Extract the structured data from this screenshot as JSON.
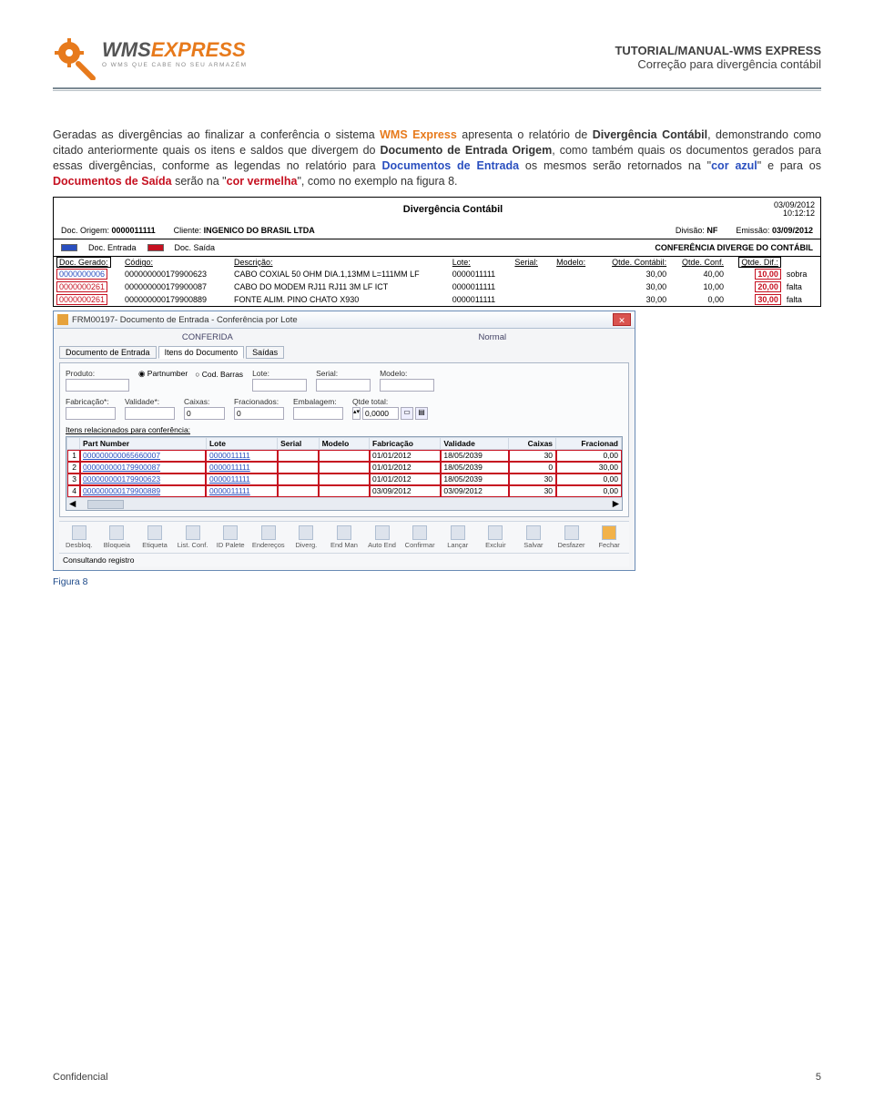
{
  "header": {
    "logo": {
      "wms": "WMS",
      "express": "EXPRESS",
      "tagline": "O WMS QUE CABE NO SEU ARMAZÉM"
    },
    "right_title": "TUTORIAL/MANUAL-WMS EXPRESS",
    "right_sub": "Correção para divergência contábil"
  },
  "paragraph": {
    "seg1": "Geradas as divergências ao finalizar a conferência o sistema ",
    "wms": "WMS Express",
    "seg2": " apresenta o relatório de ",
    "b1": "Divergência Contábil",
    "seg3": ", demonstrando como citado anteriormente quais os itens e saldos que divergem do ",
    "b2": "Documento de Entrada Origem",
    "seg4": ", como também quais os documentos gerados para essas divergências, conforme as legendas no relatório para ",
    "blue1": "Documentos de Entrada",
    "seg5": " os mesmos serão retornados na \"",
    "blue2": "cor azul",
    "seg6": "\" e para os ",
    "red1": "Documentos de Saída",
    "seg7": " serão na \"",
    "red2": "cor vermelha",
    "seg8": "\", como no exemplo na figura 8."
  },
  "report": {
    "title": "Divergência Contábil",
    "date": "03/09/2012",
    "time": "10:12:12",
    "doc_origem_label": "Doc. Origem:",
    "doc_origem": "0000011111",
    "cliente_label": "Cliente:",
    "cliente": "INGENICO DO BRASIL LTDA",
    "divisao_label": "Divisão:",
    "divisao": "NF",
    "emissao_label": "Emissão:",
    "emissao": "03/09/2012",
    "legend_in": "Doc. Entrada",
    "legend_out": "Doc. Saída",
    "conf_div": "CONFERÊNCIA DIVERGE DO CONTÁBIL",
    "cols": {
      "doc": "Doc. Gerado:",
      "cod": "Código:",
      "desc": "Descrição:",
      "lote": "Lote:",
      "serial": "Serial:",
      "modelo": "Modelo:",
      "qc": "Qtde. Contábil:",
      "qf": "Qtde. Conf.",
      "qd": "Qtde. Dif.:",
      "status": ""
    },
    "rows": [
      {
        "doc": "0000000006",
        "doc_color": "blue",
        "cod": "000000000179900623",
        "desc": "CABO COXIAL 50 OHM DIA.1,13MM L=111MM LF",
        "lote": "0000011111",
        "serial": "",
        "modelo": "",
        "qc": "30,00",
        "qf": "40,00",
        "qd": "10,00",
        "status": "sobra"
      },
      {
        "doc": "0000000261",
        "doc_color": "red",
        "cod": "000000000179900087",
        "desc": "CABO DO MODEM RJ11 RJ11 3M LF ICT",
        "lote": "0000011111",
        "serial": "",
        "modelo": "",
        "qc": "30,00",
        "qf": "10,00",
        "qd": "20,00",
        "status": "falta"
      },
      {
        "doc": "0000000261",
        "doc_color": "red",
        "cod": "000000000179900889",
        "desc": "FONTE ALIM. PINO CHATO X930",
        "lote": "0000011111",
        "serial": "",
        "modelo": "",
        "qc": "30,00",
        "qf": "0,00",
        "qd": "30,00",
        "status": "falta"
      }
    ]
  },
  "form": {
    "win_title": "FRM00197- Documento de Entrada - Conferência por Lote",
    "status_top_left": "CONFERIDA",
    "status_top_right": "Normal",
    "tabs": [
      "Documento de Entrada",
      "Itens do Documento",
      "Saídas"
    ],
    "active_tab": 1,
    "labels": {
      "produto": "Produto:",
      "partnumber": "Partnumber",
      "codbarras": "Cod. Barras",
      "lote": "Lote:",
      "serial": "Serial:",
      "modelo": "Modelo:",
      "fabricacao": "Fabricação*:",
      "validade": "Validade*:",
      "caixas": "Caixas:",
      "fracionados": "Fracionados:",
      "embalagem": "Embalagem:",
      "qtde_total": "Qtde total:"
    },
    "values": {
      "caixas": "0",
      "fracionados": "0",
      "qtde_total": "0,0000"
    },
    "section": "Itens relacionados para conferência:",
    "grid_cols": [
      "",
      "Part Number",
      "Lote",
      "Serial",
      "Modelo",
      "Fabricação",
      "Validade",
      "Caixas",
      "Fracionad"
    ],
    "grid_rows": [
      {
        "n": "1",
        "pn": "000000000065660007",
        "lote": "0000011111",
        "serial": "",
        "modelo": "",
        "fab": "01/01/2012",
        "val": "18/05/2039",
        "cx": "30",
        "frac": "0,00",
        "hl": "red"
      },
      {
        "n": "2",
        "pn": "000000000179900087",
        "lote": "0000011111",
        "serial": "",
        "modelo": "",
        "fab": "01/01/2012",
        "val": "18/05/2039",
        "cx": "0",
        "frac": "30,00",
        "hl": "red"
      },
      {
        "n": "3",
        "pn": "000000000179900623",
        "lote": "0000011111",
        "serial": "",
        "modelo": "",
        "fab": "01/01/2012",
        "val": "18/05/2039",
        "cx": "30",
        "frac": "0,00",
        "hl": "red"
      },
      {
        "n": "4",
        "pn": "000000000179900889",
        "lote": "0000011111",
        "serial": "",
        "modelo": "",
        "fab": "03/09/2012",
        "val": "03/09/2012",
        "cx": "30",
        "frac": "0,00",
        "hl": "red"
      }
    ],
    "toolbar": [
      "Desbloq.",
      "Bloqueia",
      "Etiqueta",
      "List. Conf.",
      "ID Palete",
      "Endereços",
      "Diverg.",
      "End Man",
      "Auto End",
      "Confirmar",
      "Lançar",
      "Excluir",
      "Salvar",
      "Desfazer",
      "Fechar"
    ],
    "statusbar": "Consultando registro"
  },
  "figure_caption": "Figura 8",
  "footer": {
    "left": "Confidencial",
    "right": "5"
  }
}
